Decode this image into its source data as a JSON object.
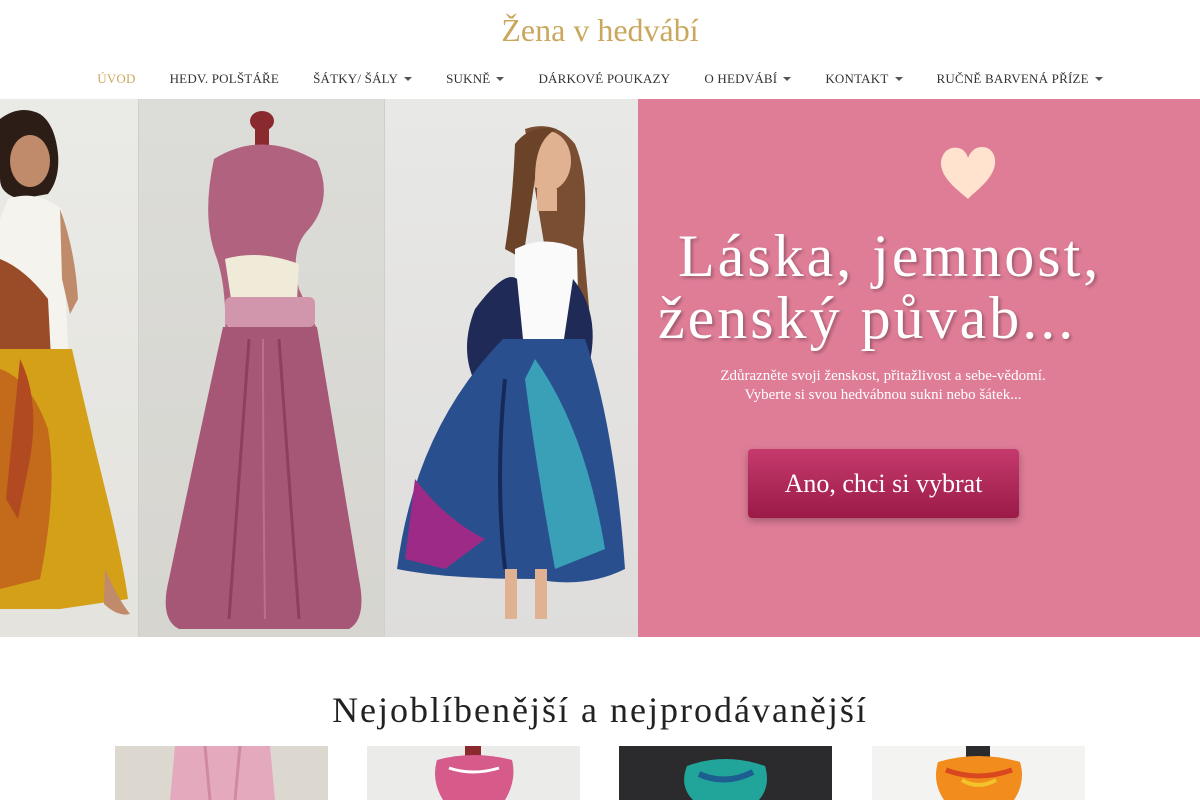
{
  "header": {
    "site_title": "Žena v hedvábí"
  },
  "nav": {
    "items": [
      {
        "label": "ÚVOD",
        "active": true,
        "dropdown": false
      },
      {
        "label": "HEDV. POLŠTÁŘE",
        "active": false,
        "dropdown": false
      },
      {
        "label": "ŠÁTKY/ ŠÁLY",
        "active": false,
        "dropdown": true
      },
      {
        "label": "SUKNĚ",
        "active": false,
        "dropdown": true
      },
      {
        "label": "DÁRKOVÉ POUKAZY",
        "active": false,
        "dropdown": false
      },
      {
        "label": "O HEDVÁBÍ",
        "active": false,
        "dropdown": true
      },
      {
        "label": "KONTAKT",
        "active": false,
        "dropdown": true
      },
      {
        "label": "RUČNĚ BARVENÁ PŘÍZE",
        "active": false,
        "dropdown": true
      }
    ]
  },
  "hero": {
    "headline_line1": "Láska, jemnost,",
    "headline_line2": "ženský půvab...",
    "subtext_line1": "Zdůrazněte svoji ženskost, přitažlivost a sebe-vědomí.",
    "subtext_line2": "Vyberte si svou hedvábnou sukni nebo šátek...",
    "cta_label": "Ano, chci si vybrat",
    "panel_color": "#df7d97",
    "heart_color": "#ffe3cf",
    "cta_color": "#b02a5a"
  },
  "products": {
    "section_title": "Nejoblíbenější a nejprodávanější"
  },
  "colors": {
    "accent": "#c9a85e"
  }
}
